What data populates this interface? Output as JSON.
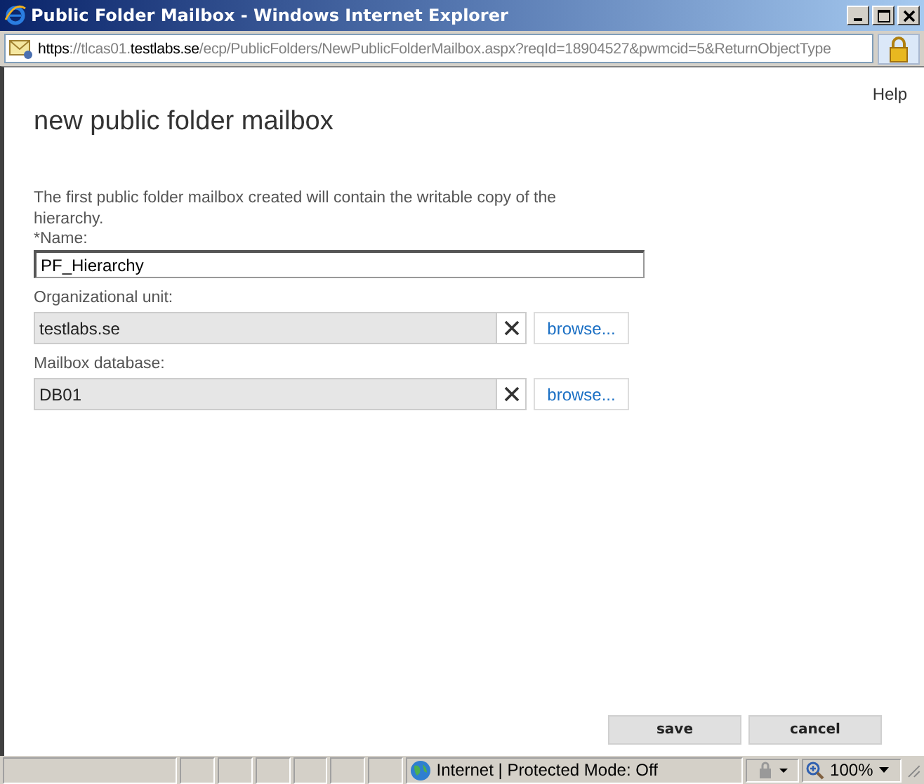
{
  "window": {
    "title": "Public Folder Mailbox - Windows Internet Explorer"
  },
  "address": "**https**://tlcas01.**testlabs.se**/ecp/PublicFolders/NewPublicFolderMailbox.aspx?reqId=18904527&pwmcid=5&ReturnObjectType",
  "help": "Help",
  "heading": "new public folder mailbox",
  "description": "The first public folder mailbox created will contain the writable copy of the hierarchy.",
  "fields": [
    {
      "kind": "text",
      "label": "*Name:",
      "value": "PF_Hierarchy"
    },
    {
      "kind": "picker",
      "label": "Organizational unit:",
      "value": "testlabs.se",
      "button": "browse..."
    },
    {
      "kind": "picker",
      "label": "Mailbox database:",
      "value": "DB01",
      "button": "browse..."
    }
  ],
  "buttons": [
    "save",
    "cancel"
  ],
  "status_bar": {
    "zone": "Internet | Protected Mode: Off",
    "zoom": "100%"
  }
}
